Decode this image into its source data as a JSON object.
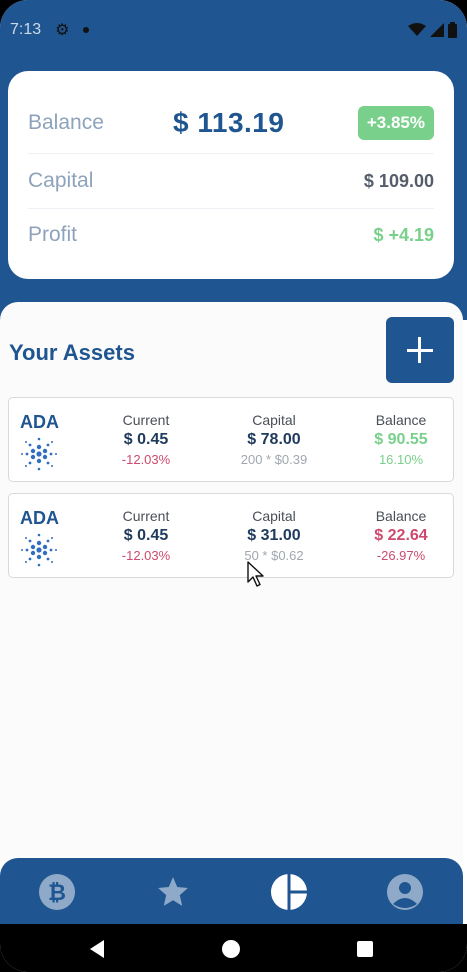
{
  "status_bar": {
    "time": "7:13"
  },
  "summary": {
    "balance_label": "Balance",
    "balance_value": "$ 113.19",
    "balance_change": "+3.85%",
    "capital_label": "Capital",
    "capital_value": "$ 109.00",
    "profit_label": "Profit",
    "profit_value": "$ +4.19",
    "colors": {
      "accent": "#1f5590",
      "positive": "#79d08b",
      "negative": "#cc4a6e"
    }
  },
  "assets": {
    "title": "Your Assets",
    "add_icon": "plus-icon",
    "items": [
      {
        "symbol": "ADA",
        "current_label": "Current",
        "current_price": "$ 0.45",
        "current_change": "-12.03%",
        "capital_label": "Capital",
        "capital_value": "$ 78.00",
        "capital_detail": "200 * $0.39",
        "balance_label": "Balance",
        "balance_value": "$ 90.55",
        "balance_change": "16.10%"
      },
      {
        "symbol": "ADA",
        "current_label": "Current",
        "current_price": "$ 0.45",
        "current_change": "-12.03%",
        "capital_label": "Capital",
        "capital_value": "$ 31.00",
        "capital_detail": "50 * $0.62",
        "balance_label": "Balance",
        "balance_value": "$ 22.64",
        "balance_change": "-26.97%"
      }
    ]
  },
  "bottom_nav": {
    "items": [
      "bitcoin-icon",
      "star-icon",
      "pie-chart-icon",
      "profile-icon"
    ],
    "active": "pie-chart-icon"
  },
  "system_nav": [
    "back-icon",
    "home-icon",
    "recents-icon"
  ]
}
